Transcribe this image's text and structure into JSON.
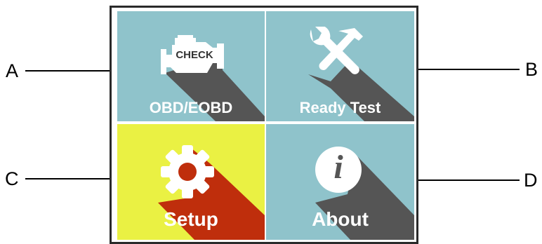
{
  "menu": {
    "tiles": [
      {
        "label": "OBD/EOBD",
        "icon": "check-engine-icon",
        "icon_text": "CHECK",
        "bg_color": "#8fc3cb",
        "selected": false
      },
      {
        "label": "Ready Test",
        "icon": "tools-icon",
        "bg_color": "#8fc3cb",
        "selected": false
      },
      {
        "label": "Setup",
        "icon": "gear-icon",
        "bg_color": "#eaf143",
        "selected": true
      },
      {
        "label": "About",
        "icon": "info-icon",
        "icon_text": "i",
        "bg_color": "#8fc3cb",
        "selected": false
      }
    ]
  },
  "callouts": {
    "a": "A",
    "b": "B",
    "c": "C",
    "d": "D"
  },
  "colors": {
    "tile_bg": "#8fc3cb",
    "selected_bg": "#eaf143",
    "shadow": "#555555",
    "selected_shadow": "#bf2e0c",
    "frame": "#2a2a2a"
  }
}
